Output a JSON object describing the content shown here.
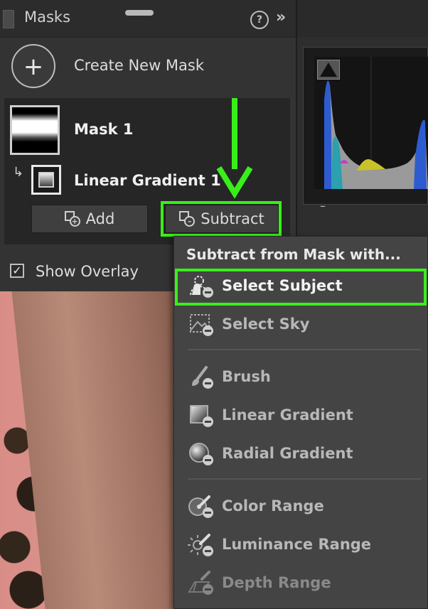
{
  "panel": {
    "title": "Masks",
    "help_glyph": "?",
    "expand_glyph": "»",
    "create_label": "Create New Mask",
    "create_glyph": "+",
    "mask_name": "Mask 1",
    "child_arrow": "↳",
    "component_name": "Linear Gradient 1",
    "add_label": "Add",
    "subtract_label": "Subtract",
    "show_overlay_label": "Show Overlay",
    "show_overlay_checked": true,
    "check_glyph": "✓"
  },
  "histogram": {
    "dash": "–"
  },
  "menu": {
    "header": "Subtract from Mask with...",
    "items": [
      {
        "label": "Select Subject",
        "icon": "select-subject-icon"
      },
      {
        "label": "Select Sky",
        "icon": "select-sky-icon"
      },
      {
        "label": "Brush",
        "icon": "brush-icon"
      },
      {
        "label": "Linear Gradient",
        "icon": "linear-gradient-icon"
      },
      {
        "label": "Radial Gradient",
        "icon": "radial-gradient-icon"
      },
      {
        "label": "Color Range",
        "icon": "color-range-icon"
      },
      {
        "label": "Luminance Range",
        "icon": "luminance-range-icon"
      },
      {
        "label": "Depth Range",
        "icon": "depth-range-icon"
      }
    ]
  },
  "colors": {
    "highlight": "#39ef1a",
    "panel_bg": "#333333",
    "menu_bg": "#444444"
  }
}
